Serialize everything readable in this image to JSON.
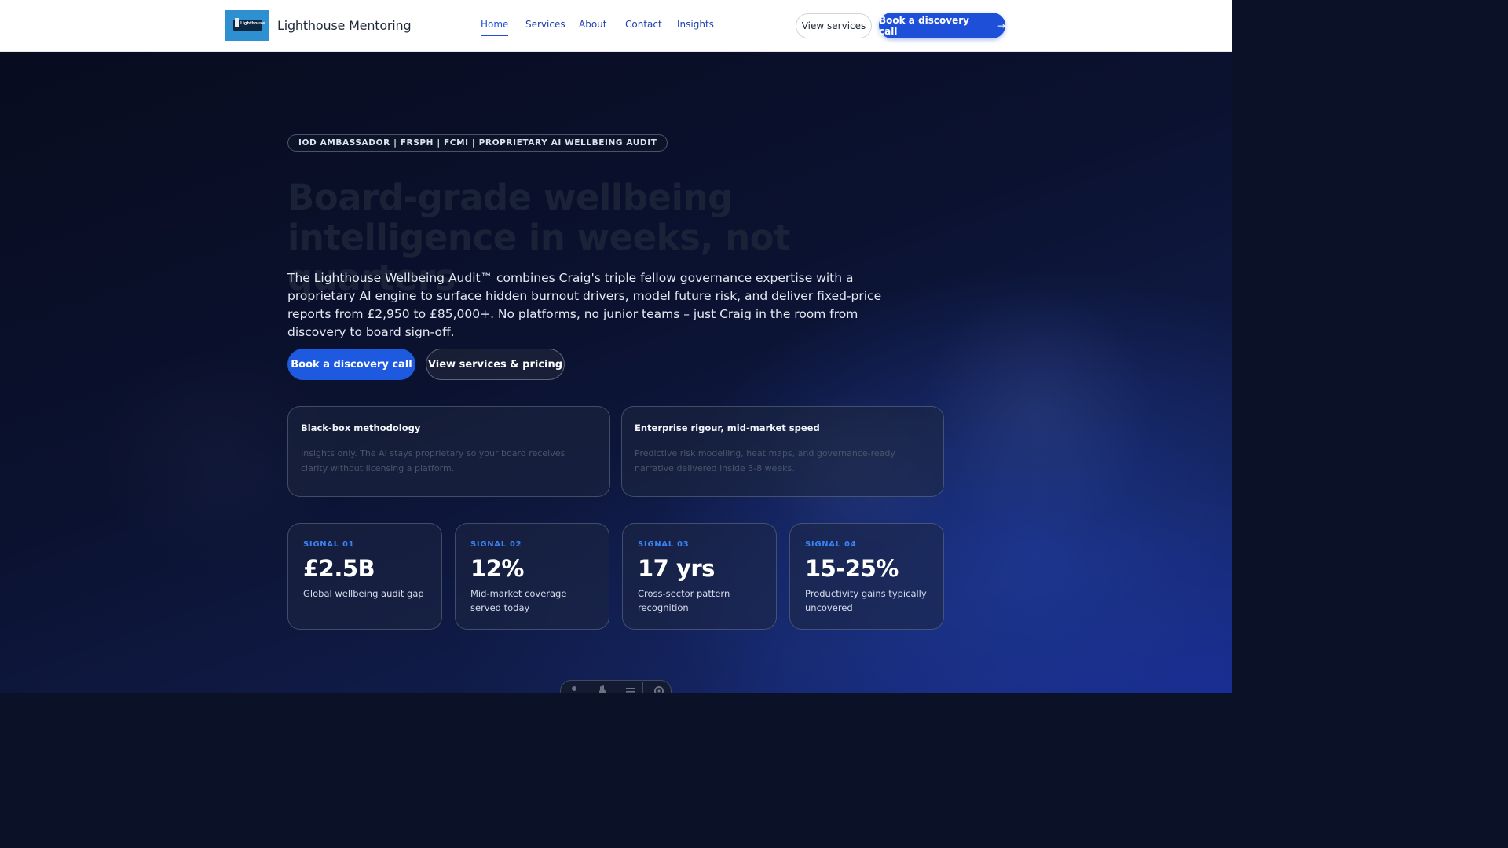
{
  "header": {
    "logo_text": "Lighthouse",
    "brand_name": "Lighthouse Mentoring",
    "nav": [
      {
        "label": "Home",
        "active": true
      },
      {
        "label": "Services",
        "active": false
      },
      {
        "label": "About",
        "active": false
      },
      {
        "label": "Contact",
        "active": false
      },
      {
        "label": "Insights",
        "active": false
      }
    ],
    "view_services_label": "View services",
    "book_call_label": "Book a discovery call",
    "book_call_icon": "arrow-right-icon"
  },
  "hero": {
    "badge": "IOD AMBASSADOR | FRSPH | FCMI | PROPRIETARY AI WELLBEING AUDIT",
    "headline": "Board-grade wellbeing intelligence in weeks, not quarters",
    "lede": "The Lighthouse Wellbeing Audit™ combines Craig's triple fellow governance expertise with a proprietary AI engine to surface hidden burnout drivers, model future risk, and deliver fixed-price reports from £2,950 to £85,000+. No platforms, no junior teams – just Craig in the room from discovery to board sign-off.",
    "primary_cta": "Book a discovery call",
    "secondary_cta": "View services & pricing"
  },
  "features": [
    {
      "title": "Black-box methodology",
      "description": "Insights only. The AI stays proprietary so your board receives clarity without licensing a platform."
    },
    {
      "title": "Enterprise rigour, mid-market speed",
      "description": "Predictive risk modelling, heat maps, and governance-ready narrative delivered inside 3-8 weeks."
    }
  ],
  "signals": [
    {
      "label": "SIGNAL 01",
      "value": "£2.5B",
      "description": "Global wellbeing audit gap"
    },
    {
      "label": "SIGNAL 02",
      "value": "12%",
      "description": "Mid-market coverage served today"
    },
    {
      "label": "SIGNAL 03",
      "value": "17 yrs",
      "description": "Cross-sector pattern recognition"
    },
    {
      "label": "SIGNAL 04",
      "value": "15-25%",
      "description": "Productivity gains typically uncovered"
    }
  ],
  "dock": {
    "icons": [
      "person-icon",
      "hand-icon",
      "menu-icon",
      "settings-icon"
    ]
  },
  "colors": {
    "accent": "#1d4fd8",
    "signal_label": "#3b82f6",
    "hero_bg_dark": "#080c1f",
    "hero_bg_blue": "#16288a"
  }
}
